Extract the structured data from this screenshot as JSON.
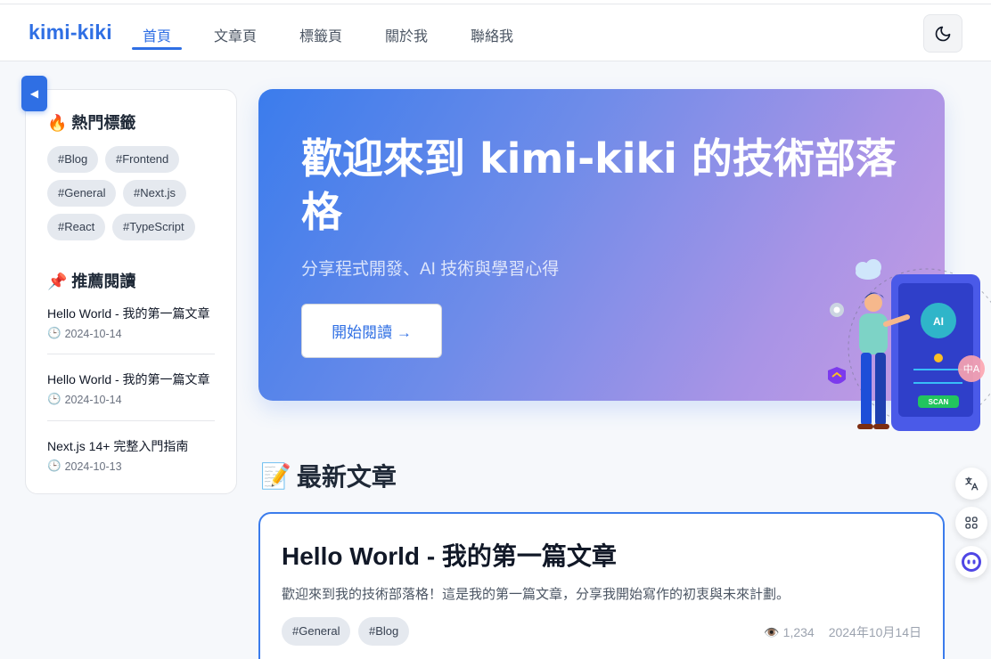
{
  "navbar": {
    "brand": "kimi-kiki",
    "links": [
      "首頁",
      "文章頁",
      "標籤頁",
      "關於我",
      "聯絡我"
    ],
    "active_index": 0,
    "theme_icon": "moon-icon"
  },
  "sidebar": {
    "toggle_glyph": "◀",
    "tags_heading": "🔥 熱門標籤",
    "tags": [
      "#Blog",
      "#Frontend",
      "#General",
      "#Next.js",
      "#React",
      "#TypeScript"
    ],
    "recommended_heading": "📌 推薦閱讀",
    "recommended": [
      {
        "title": "Hello World - 我的第一篇文章",
        "date": "2024-10-14"
      },
      {
        "title": "Hello World - 我的第一篇文章",
        "date": "2024-10-14"
      },
      {
        "title": "Next.js 14+ 完整入門指南",
        "date": "2024-10-13"
      }
    ],
    "clock_glyph": "🕒"
  },
  "hero": {
    "title": "歡迎來到 kimi-kiki 的技術部落格",
    "subtitle": "分享程式開發、AI 技術與學習心得",
    "button_label": "開始閱讀 →",
    "illustration_text": "AI",
    "scan_label": "SCAN"
  },
  "latest": {
    "heading_icon": "📝",
    "heading": "最新文章",
    "articles": [
      {
        "title": "Hello World - 我的第一篇文章",
        "excerpt": "歡迎來到我的技術部落格！這是我的第一篇文章，分享我開始寫作的初衷與未來計劃。",
        "tags": [
          "#General",
          "#Blog"
        ],
        "views_icon": "👁️",
        "views": "1,234",
        "date": "2024年10月14日"
      }
    ]
  },
  "colors": {
    "accent": "#2f6fe4",
    "hero_gradient_start": "#3b7cec",
    "hero_gradient_end": "#c69ce3"
  }
}
